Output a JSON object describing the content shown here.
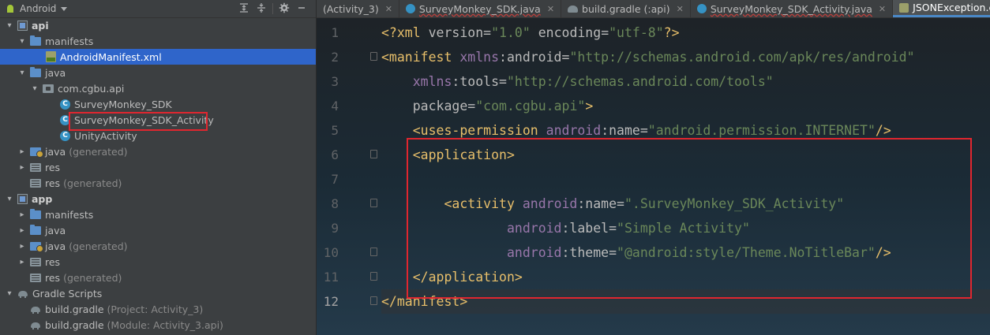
{
  "project_panel": {
    "title": "Android",
    "tools": [
      "collapse-all-icon",
      "expand-all-icon",
      "gear-icon",
      "minimize-icon"
    ],
    "tree": [
      {
        "label": "api",
        "suffix": "",
        "icon": "module-icon",
        "expanded": true,
        "level": 0,
        "bold": true
      },
      {
        "label": "manifests",
        "suffix": "",
        "icon": "folder-icon",
        "expanded": true,
        "level": 1
      },
      {
        "label": "AndroidManifest.xml",
        "suffix": "",
        "icon": "manifest-file-icon",
        "level": 2,
        "selected": true
      },
      {
        "label": "java",
        "suffix": "",
        "icon": "folder-icon",
        "expanded": true,
        "level": 1
      },
      {
        "label": "com.cgbu.api",
        "suffix": "",
        "icon": "package-icon",
        "expanded": true,
        "level": 2
      },
      {
        "label": "SurveyMonkey_SDK",
        "suffix": "",
        "icon": "class-icon",
        "level": 3
      },
      {
        "label": "SurveyMonkey_SDK_Activity",
        "suffix": "",
        "icon": "class-icon",
        "level": 3,
        "boxed": true
      },
      {
        "label": "UnityActivity",
        "suffix": "",
        "icon": "class-icon",
        "level": 3
      },
      {
        "label": "java",
        "suffix": "(generated)",
        "icon": "generated-folder-icon",
        "expanded": false,
        "level": 1
      },
      {
        "label": "res",
        "suffix": "",
        "icon": "res-folder-icon",
        "expanded": false,
        "level": 1
      },
      {
        "label": "res",
        "suffix": "(generated)",
        "icon": "res-folder-icon",
        "level": 1
      },
      {
        "label": "app",
        "suffix": "",
        "icon": "module-icon",
        "expanded": true,
        "level": 0,
        "bold": true
      },
      {
        "label": "manifests",
        "suffix": "",
        "icon": "folder-icon",
        "expanded": false,
        "level": 1
      },
      {
        "label": "java",
        "suffix": "",
        "icon": "folder-icon",
        "expanded": false,
        "level": 1
      },
      {
        "label": "java",
        "suffix": "(generated)",
        "icon": "generated-folder-icon",
        "expanded": false,
        "level": 1
      },
      {
        "label": "res",
        "suffix": "",
        "icon": "res-folder-icon",
        "expanded": false,
        "level": 1
      },
      {
        "label": "res",
        "suffix": "(generated)",
        "icon": "res-folder-icon",
        "level": 1
      },
      {
        "label": "Gradle Scripts",
        "suffix": "",
        "icon": "gradle-icon",
        "expanded": true,
        "level": 0
      },
      {
        "label": "build.gradle",
        "suffix": "(Project: Activity_3)",
        "icon": "gradle-icon",
        "level": 1
      },
      {
        "label": "build.gradle",
        "suffix": "(Module: Activity_3.api)",
        "icon": "gradle-icon",
        "level": 1
      }
    ]
  },
  "editor": {
    "tabs": [
      {
        "label": "(Activity_3)",
        "icon": "",
        "active": false,
        "wavy": false
      },
      {
        "label": "SurveyMonkey_SDK.java",
        "icon": "class-icon",
        "active": false,
        "wavy": true
      },
      {
        "label": "build.gradle (:api)",
        "icon": "gradle-icon",
        "active": false,
        "wavy": false
      },
      {
        "label": "SurveyMonkey_SDK_Activity.java",
        "icon": "class-icon",
        "active": false,
        "wavy": true
      },
      {
        "label": "JSONException.class",
        "icon": "class-file-icon",
        "active": true,
        "wavy": false
      }
    ],
    "line_numbers": [
      "1",
      "2",
      "3",
      "4",
      "5",
      "6",
      "7",
      "8",
      "9",
      "10",
      "11",
      "12"
    ],
    "current_line": 12,
    "code_lines": [
      "<?xml version=\"1.0\" encoding=\"utf-8\"?>",
      "<manifest xmlns:android=\"http://schemas.android.com/apk/res/android\"",
      "    xmlns:tools=\"http://schemas.android.com/tools\"",
      "    package=\"com.cgbu.api\">",
      "    <uses-permission android:name=\"android.permission.INTERNET\"/>",
      "    <application>",
      "",
      "        <activity android:name=\".SurveyMonkey_SDK_Activity\"",
      "                android:label=\"Simple Activity\"",
      "                android:theme=\"@android:style/Theme.NoTitleBar\"/>",
      "    </application>",
      "</manifest>"
    ]
  }
}
